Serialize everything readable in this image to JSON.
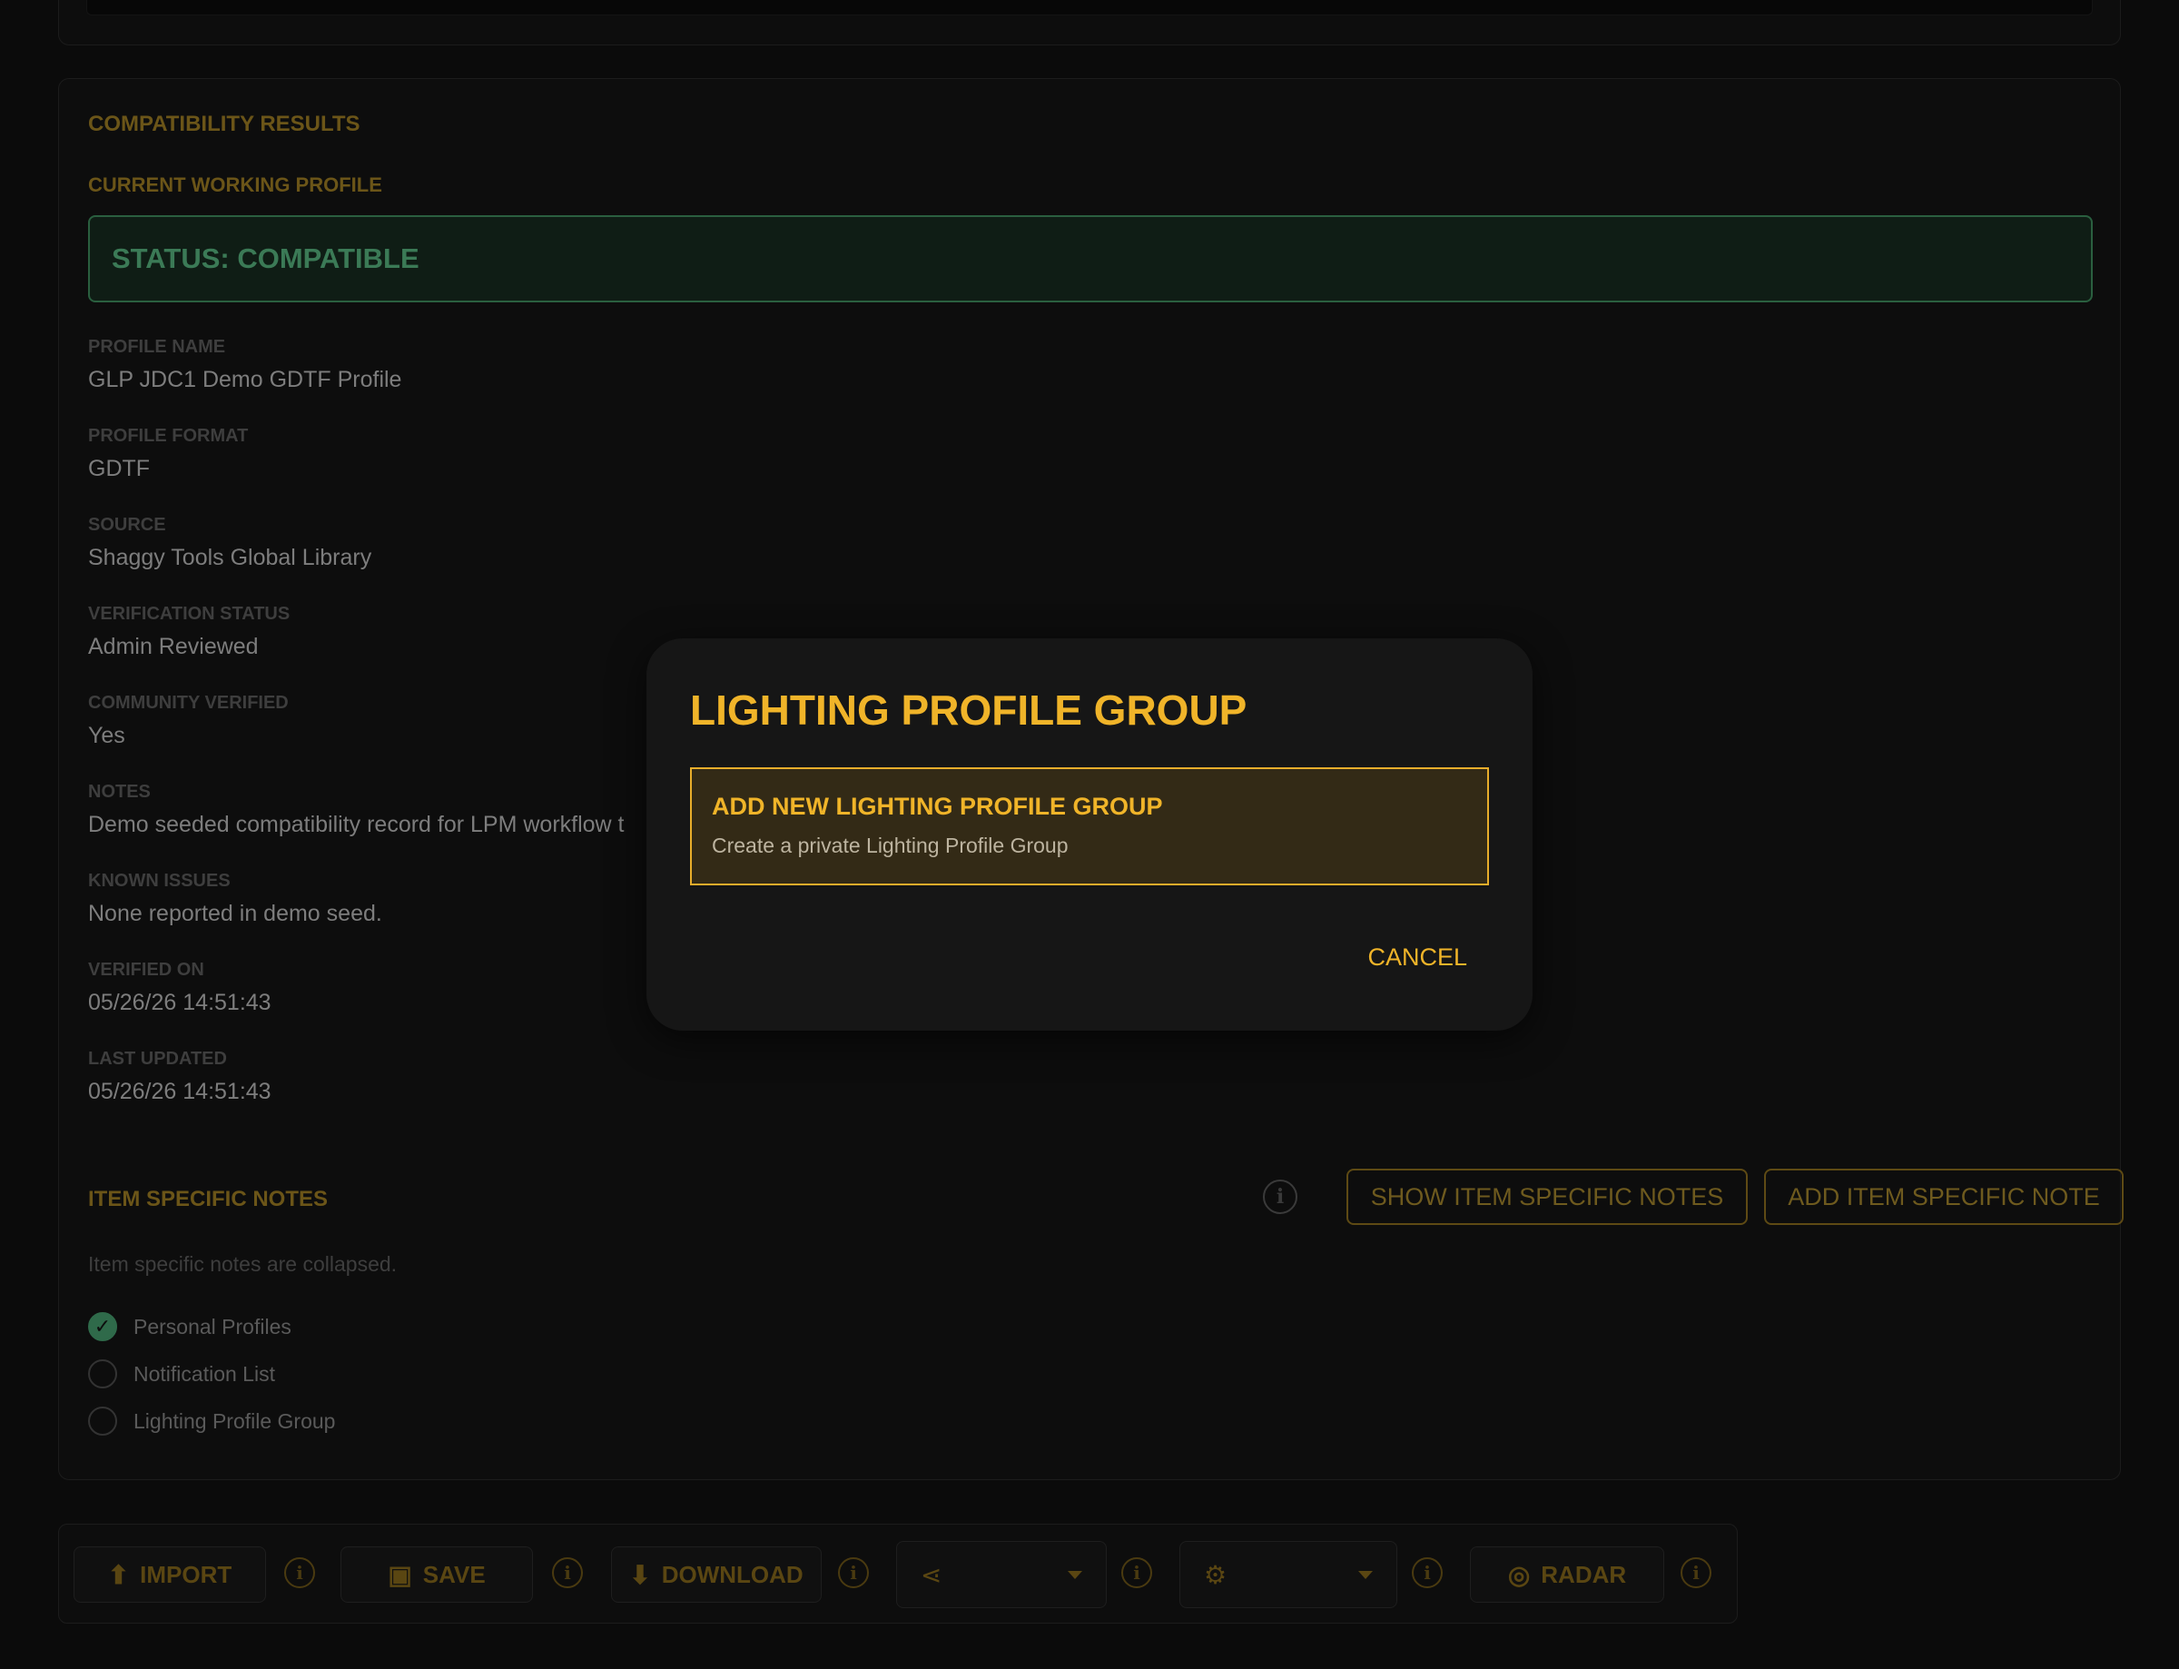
{
  "results": {
    "section_title": "COMPATIBILITY RESULTS",
    "subsection_title": "CURRENT WORKING PROFILE",
    "status": "STATUS: COMPATIBLE",
    "fields": [
      {
        "label": "PROFILE NAME",
        "value": "GLP JDC1 Demo GDTF Profile"
      },
      {
        "label": "PROFILE FORMAT",
        "value": "GDTF"
      },
      {
        "label": "SOURCE",
        "value": "Shaggy Tools Global Library"
      },
      {
        "label": "VERIFICATION STATUS",
        "value": "Admin Reviewed"
      },
      {
        "label": "COMMUNITY VERIFIED",
        "value": "Yes"
      },
      {
        "label": "NOTES",
        "value": "Demo seeded compatibility record for LPM workflow t"
      },
      {
        "label": "KNOWN ISSUES",
        "value": "None reported in demo seed."
      },
      {
        "label": "VERIFIED ON",
        "value": "05/26/26 14:51:43"
      },
      {
        "label": "LAST UPDATED",
        "value": "05/26/26 14:51:43"
      }
    ]
  },
  "item_notes": {
    "title": "ITEM SPECIFIC NOTES",
    "info_glyph": "i",
    "show_label": "SHOW ITEM SPECIFIC NOTES",
    "add_label": "ADD ITEM SPECIFIC NOTE",
    "collapsed_text": "Item specific notes are collapsed."
  },
  "lists": [
    {
      "label": "Personal Profiles",
      "checked": true
    },
    {
      "label": "Notification List",
      "checked": false
    },
    {
      "label": "Lighting Profile Group",
      "checked": false
    }
  ],
  "toolbar": {
    "import_label": "IMPORT",
    "save_label": "SAVE",
    "download_label": "DOWNLOAD",
    "radar_label": "RADAR",
    "info_glyph": "i"
  },
  "modal": {
    "title": "LIGHTING PROFILE GROUP",
    "option_title": "ADD NEW LIGHTING PROFILE GROUP",
    "option_subtitle": "Create a private Lighting Profile Group",
    "cancel_label": "CANCEL"
  },
  "colors": {
    "accent": "#f0b429",
    "success": "#2f6a4a",
    "background": "#0b0b0b"
  },
  "icons": [
    "upload-icon",
    "save-icon",
    "download-icon",
    "share-icon",
    "person-settings-icon",
    "radar-icon",
    "info-icon",
    "check-icon"
  ]
}
